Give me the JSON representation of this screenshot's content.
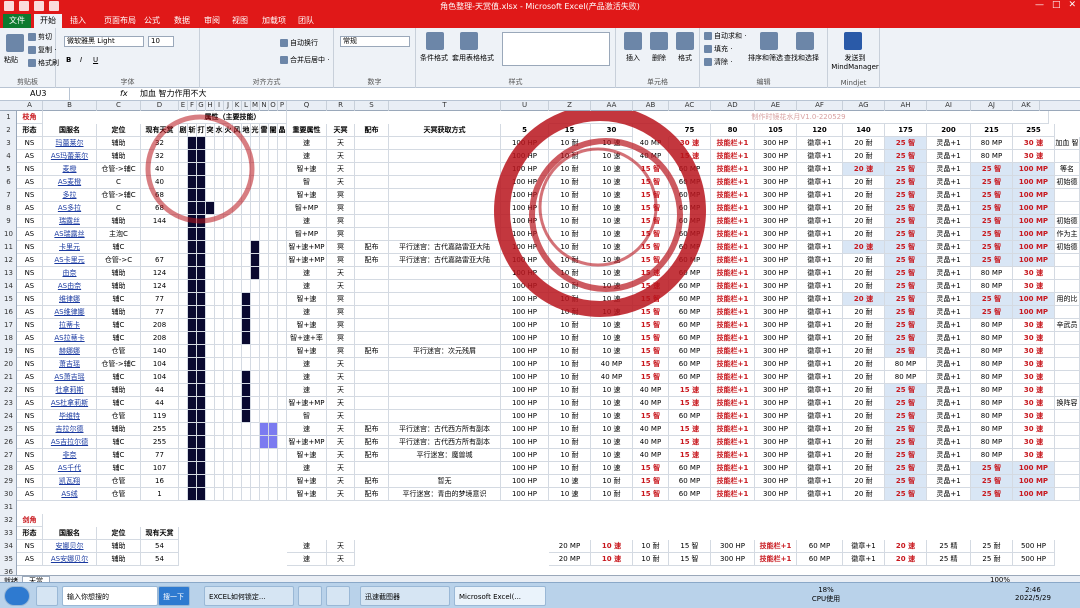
{
  "window": {
    "title": "角色整理-天赏值.xlsx - Microsoft Excel(产品激活失败)"
  },
  "menu_tabs": [
    {
      "label": "文件"
    },
    {
      "label": "开始"
    },
    {
      "label": "插入"
    },
    {
      "label": "页面布局"
    },
    {
      "label": "公式"
    },
    {
      "label": "数据"
    },
    {
      "label": "审阅"
    },
    {
      "label": "视图"
    },
    {
      "label": "加载项"
    },
    {
      "label": "团队"
    }
  ],
  "ribbon": {
    "clipboard": {
      "paste": "粘贴",
      "cut": "剪切",
      "copy": "复制 ·",
      "format_painter": "格式刷",
      "label": "剪贴板"
    },
    "font": {
      "name": "微软雅黑 Light",
      "size": "10",
      "bold": "B",
      "italic": "I",
      "underline": "U",
      "label": "字体"
    },
    "alignment": {
      "wrap": "自动换行",
      "merge": "合并后居中 ·",
      "label": "对齐方式"
    },
    "number": {
      "format": "常规",
      "label": "数字"
    },
    "styles": {
      "conditional": "条件格式",
      "table": "套用表格格式",
      "label": "样式"
    },
    "cells": {
      "insert": "插入",
      "delete": "删除",
      "format": "格式",
      "label": "单元格"
    },
    "editing": {
      "autosum": "自动求和 ·",
      "fill": "填充 ·",
      "clear": "清除 ·",
      "sort": "排序和筛选",
      "find": "查找和选择",
      "label": "编辑"
    },
    "mindjet": {
      "send": "发送到 MindManager",
      "label": "Mindjet"
    }
  },
  "formula_bar": {
    "name_box": "AU3",
    "fx": "fx",
    "content": "加血 智力作用不大"
  },
  "columns": [
    "A",
    "B",
    "C",
    "D",
    "E",
    "F",
    "G",
    "H",
    "I",
    "J",
    "K",
    "L",
    "M",
    "N",
    "O",
    "P",
    "Q",
    "R",
    "S",
    "T",
    "U",
    "Z",
    "AA",
    "AB",
    "AC",
    "AD",
    "AE",
    "AF",
    "AG",
    "AH",
    "AI",
    "AJ",
    "AK",
    "AL",
    "AM",
    "AN",
    "AO",
    "AP",
    "AQ",
    "AR",
    "AS",
    "AT"
  ],
  "group_title": "属性（主要技能）",
  "watermark": "制作时镜花水月V1.0-220529",
  "headers": {
    "section_a": "枝角",
    "row2": [
      "形态",
      "国服名",
      "定位",
      "现有天赏"
    ],
    "attr_letters": [
      "剧",
      "斩",
      "打",
      "突",
      "水",
      "火",
      "风",
      "地",
      "光",
      "雷",
      "闇",
      "晶"
    ],
    "key_attr": "重要属性",
    "tianming": "天冥",
    "peifu": "配布",
    "method": "天冥获取方式",
    "levels": [
      "5",
      "15",
      "30",
      "75",
      "80",
      "105",
      "120",
      "140",
      "175",
      "200",
      "215",
      "255"
    ]
  },
  "rows": [
    {
      "r": "3",
      "form": "NS",
      "name": "玛蕾莱尔",
      "role": "辅助",
      "cnt": "32",
      "key": "速",
      "tm": "天",
      "pf": "",
      "src": "",
      "v": [
        "100 HP",
        "10 耐",
        "10 速",
        "40 MP",
        "30 速",
        "技能栏+1",
        "300 HP",
        "徽章+1",
        "20 耐",
        "25 智",
        "灵晶+1",
        "80 MP",
        "30 速"
      ],
      "note": "加血 智"
    },
    {
      "r": "4",
      "form": "AS",
      "name": "AS玛蕾莱尔",
      "role": "辅助",
      "cnt": "32",
      "key": "速",
      "tm": "天",
      "pf": "",
      "src": "",
      "v": [
        "100 HP",
        "10 耐",
        "10 速",
        "40 MP",
        "15 速",
        "技能栏+1",
        "300 HP",
        "徽章+1",
        "20 耐",
        "25 智",
        "灵晶+1",
        "80 MP",
        "30 速"
      ],
      "note": ""
    },
    {
      "r": "5",
      "form": "NS",
      "name": "麦橙",
      "role": "仓管->辅C",
      "cnt": "40",
      "key": "智+速",
      "tm": "天",
      "pf": "",
      "src": "",
      "v": [
        "100 HP",
        "10 耐",
        "10 速",
        "15 智",
        "60 MP",
        "技能栏+1",
        "300 HP",
        "徽章+1",
        "20 速",
        "25 智",
        "灵晶+1",
        "25 智",
        "100 MP"
      ],
      "note": "等名"
    },
    {
      "r": "6",
      "form": "AS",
      "name": "AS麦橙",
      "role": "C",
      "cnt": "40",
      "key": "智",
      "tm": "天",
      "pf": "",
      "src": "",
      "v": [
        "100 HP",
        "10 耐",
        "10 速",
        "15 智",
        "60 MP",
        "技能栏+1",
        "300 HP",
        "徽章+1",
        "20 耐",
        "25 智",
        "灵晶+1",
        "25 智",
        "100 MP"
      ],
      "note": "初始德"
    },
    {
      "r": "7",
      "form": "NS",
      "name": "多拉",
      "role": "仓管->辅C",
      "cnt": "68",
      "key": "智+速",
      "tm": "冥",
      "pf": "",
      "src": "",
      "v": [
        "100 HP",
        "10 耐",
        "10 速",
        "15 智",
        "60 MP",
        "技能栏+1",
        "300 HP",
        "徽章+1",
        "20 耐",
        "25 智",
        "灵晶+1",
        "25 智",
        "100 MP"
      ],
      "note": ""
    },
    {
      "r": "8",
      "form": "AS",
      "name": "AS多拉",
      "role": "C",
      "cnt": "68",
      "key": "智+MP",
      "tm": "冥",
      "pf": "",
      "src": "",
      "v": [
        "100 HP",
        "10 耐",
        "10 速",
        "15 智",
        "60 MP",
        "技能栏+1",
        "300 HP",
        "徽章+1",
        "20 耐",
        "25 智",
        "灵晶+1",
        "25 智",
        "100 MP"
      ],
      "note": ""
    },
    {
      "r": "9",
      "form": "NS",
      "name": "瑞露丝",
      "role": "辅助",
      "cnt": "144",
      "key": "速",
      "tm": "冥",
      "pf": "",
      "src": "",
      "v": [
        "100 HP",
        "10 耐",
        "10 速",
        "15 智",
        "60 MP",
        "技能栏+1",
        "300 HP",
        "徽章+1",
        "20 耐",
        "25 智",
        "灵晶+1",
        "25 智",
        "100 MP"
      ],
      "note": "初始德"
    },
    {
      "r": "10",
      "form": "AS",
      "name": "AS瑞露丝",
      "role": "主泡C",
      "cnt": "",
      "key": "智+MP",
      "tm": "冥",
      "pf": "",
      "src": "",
      "v": [
        "100 HP",
        "10 耐",
        "10 速",
        "15 智",
        "60 MP",
        "技能栏+1",
        "300 HP",
        "徽章+1",
        "20 耐",
        "25 智",
        "灵晶+1",
        "25 智",
        "100 MP"
      ],
      "note": "作为主"
    },
    {
      "r": "11",
      "form": "NS",
      "name": "卡里元",
      "role": "辅C",
      "cnt": "",
      "key": "智+速+MP",
      "tm": "冥",
      "pf": "配布",
      "src": "平行迷宫：古代嘉路雷亚大陆",
      "v": [
        "100 HP",
        "10 耐",
        "10 速",
        "15 智",
        "60 MP",
        "技能栏+1",
        "300 HP",
        "徽章+1",
        "20 速",
        "25 智",
        "灵晶+1",
        "25 智",
        "100 MP"
      ],
      "note": "初始德"
    },
    {
      "r": "12",
      "form": "AS",
      "name": "AS卡里元",
      "role": "仓管->C",
      "cnt": "67",
      "key": "智+速+MP",
      "tm": "冥",
      "pf": "配布",
      "src": "平行迷宫：古代嘉路雷亚大陆",
      "v": [
        "100 HP",
        "10 耐",
        "10 速",
        "15 智",
        "60 MP",
        "技能栏+1",
        "300 HP",
        "徽章+1",
        "20 耐",
        "25 智",
        "灵晶+1",
        "25 智",
        "100 MP"
      ],
      "note": ""
    },
    {
      "r": "13",
      "form": "NS",
      "name": "由奈",
      "role": "辅助",
      "cnt": "124",
      "key": "速",
      "tm": "天",
      "pf": "",
      "src": "",
      "v": [
        "100 HP",
        "10 耐",
        "10 速",
        "15 速",
        "60 MP",
        "技能栏+1",
        "300 HP",
        "徽章+1",
        "20 耐",
        "25 智",
        "灵晶+1",
        "80 MP",
        "30 速"
      ],
      "note": ""
    },
    {
      "r": "14",
      "form": "AS",
      "name": "AS由奈",
      "role": "辅助",
      "cnt": "124",
      "key": "速",
      "tm": "天",
      "pf": "",
      "src": "",
      "v": [
        "100 HP",
        "10 耐",
        "10 速",
        "15 速",
        "60 MP",
        "技能栏+1",
        "300 HP",
        "徽章+1",
        "20 耐",
        "25 智",
        "灵晶+1",
        "80 MP",
        "30 速"
      ],
      "note": ""
    },
    {
      "r": "15",
      "form": "NS",
      "name": "维律娜",
      "role": "辅C",
      "cnt": "77",
      "key": "智+速",
      "tm": "冥",
      "pf": "",
      "src": "",
      "v": [
        "100 HP",
        "10 耐",
        "10 速",
        "15 智",
        "60 MP",
        "技能栏+1",
        "300 HP",
        "徽章+1",
        "20 速",
        "25 智",
        "灵晶+1",
        "25 智",
        "100 MP"
      ],
      "note": "用的比"
    },
    {
      "r": "16",
      "form": "AS",
      "name": "AS维律娜",
      "role": "辅助",
      "cnt": "77",
      "key": "速",
      "tm": "冥",
      "pf": "",
      "src": "",
      "v": [
        "100 HP",
        "10 耐",
        "10 速",
        "15 智",
        "60 MP",
        "技能栏+1",
        "300 HP",
        "徽章+1",
        "20 耐",
        "25 智",
        "灵晶+1",
        "25 智",
        "100 MP"
      ],
      "note": ""
    },
    {
      "r": "17",
      "form": "NS",
      "name": "拉蒂卡",
      "role": "辅C",
      "cnt": "208",
      "key": "智+速",
      "tm": "冥",
      "pf": "",
      "src": "",
      "v": [
        "100 HP",
        "10 耐",
        "10 速",
        "15 智",
        "60 MP",
        "技能栏+1",
        "300 HP",
        "徽章+1",
        "20 耐",
        "25 智",
        "灵晶+1",
        "80 MP",
        "30 速"
      ],
      "note": "辛武员"
    },
    {
      "r": "18",
      "form": "AS",
      "name": "AS拉蒂卡",
      "role": "辅C",
      "cnt": "208",
      "key": "智+速+率",
      "tm": "冥",
      "pf": "",
      "src": "",
      "v": [
        "100 HP",
        "10 耐",
        "10 速",
        "15 智",
        "60 MP",
        "技能栏+1",
        "300 HP",
        "徽章+1",
        "20 耐",
        "25 智",
        "灵晶+1",
        "80 MP",
        "30 速"
      ],
      "note": ""
    },
    {
      "r": "19",
      "form": "NS",
      "name": "赫娜娜",
      "role": "仓管",
      "cnt": "140",
      "key": "智+速",
      "tm": "冥",
      "pf": "配布",
      "src": "平行迷宫：次元残屑",
      "v": [
        "100 HP",
        "10 耐",
        "10 速",
        "15 智",
        "60 MP",
        "技能栏+1",
        "300 HP",
        "徽章+1",
        "20 耐",
        "25 智",
        "灵晶+1",
        "80 MP",
        "30 速"
      ],
      "note": ""
    },
    {
      "r": "20",
      "form": "NS",
      "name": "萧吉瑶",
      "role": "仓管->辅C",
      "cnt": "104",
      "key": "速",
      "tm": "天",
      "pf": "",
      "src": "",
      "v": [
        "100 HP",
        "10 耐",
        "40 MP",
        "15 智",
        "60 MP",
        "技能栏+1",
        "300 HP",
        "徽章+1",
        "20 耐",
        "80 MP",
        "灵晶+1",
        "80 MP",
        "30 速"
      ],
      "note": ""
    },
    {
      "r": "21",
      "form": "AS",
      "name": "AS萧吉瑶",
      "role": "辅C",
      "cnt": "104",
      "key": "速",
      "tm": "天",
      "pf": "",
      "src": "",
      "v": [
        "100 HP",
        "10 耐",
        "40 MP",
        "15 智",
        "60 MP",
        "技能栏+1",
        "300 HP",
        "徽章+1",
        "20 耐",
        "80 MP",
        "灵晶+1",
        "80 MP",
        "30 速"
      ],
      "note": ""
    },
    {
      "r": "22",
      "form": "NS",
      "name": "杜拿莉斯",
      "role": "辅助",
      "cnt": "44",
      "key": "速",
      "tm": "天",
      "pf": "",
      "src": "",
      "v": [
        "100 HP",
        "10 耐",
        "10 速",
        "40 MP",
        "15 速",
        "技能栏+1",
        "300 HP",
        "徽章+1",
        "20 耐",
        "25 智",
        "灵晶+1",
        "80 MP",
        "30 速"
      ],
      "note": ""
    },
    {
      "r": "23",
      "form": "AS",
      "name": "AS杜拿莉斯",
      "role": "辅C",
      "cnt": "44",
      "key": "智+速+MP",
      "tm": "天",
      "pf": "",
      "src": "",
      "v": [
        "100 HP",
        "10 耐",
        "10 速",
        "40 MP",
        "15 速",
        "技能栏+1",
        "300 HP",
        "徽章+1",
        "20 耐",
        "25 智",
        "灵晶+1",
        "80 MP",
        "30 速"
      ],
      "note": "换阵容"
    },
    {
      "r": "24",
      "form": "NS",
      "name": "毕维特",
      "role": "仓管",
      "cnt": "119",
      "key": "智",
      "tm": "天",
      "pf": "",
      "src": "",
      "v": [
        "100 HP",
        "10 耐",
        "10 速",
        "15 智",
        "60 MP",
        "技能栏+1",
        "300 HP",
        "徽章+1",
        "20 耐",
        "25 智",
        "灵晶+1",
        "80 MP",
        "30 速"
      ],
      "note": ""
    },
    {
      "r": "25",
      "form": "NS",
      "name": "吉拉尔德",
      "role": "辅助",
      "cnt": "255",
      "key": "速",
      "tm": "天",
      "pf": "配布",
      "src": "平行迷宫：古代西方所有副本",
      "v": [
        "100 HP",
        "10 耐",
        "10 速",
        "40 MP",
        "15 速",
        "技能栏+1",
        "300 HP",
        "徽章+1",
        "20 耐",
        "25 智",
        "灵晶+1",
        "80 MP",
        "30 速"
      ],
      "note": ""
    },
    {
      "r": "26",
      "form": "AS",
      "name": "AS吉拉尔德",
      "role": "辅C",
      "cnt": "255",
      "key": "智+速+MP",
      "tm": "天",
      "pf": "配布",
      "src": "平行迷宫：古代西方所有副本",
      "v": [
        "100 HP",
        "10 耐",
        "10 速",
        "40 MP",
        "15 速",
        "技能栏+1",
        "300 HP",
        "徽章+1",
        "20 耐",
        "25 智",
        "灵晶+1",
        "80 MP",
        "30 速"
      ],
      "note": ""
    },
    {
      "r": "27",
      "form": "NS",
      "name": "非奈",
      "role": "辅C",
      "cnt": "77",
      "key": "智+速",
      "tm": "天",
      "pf": "配布",
      "src": "平行迷宫：魔兽城",
      "v": [
        "100 HP",
        "10 耐",
        "10 速",
        "40 MP",
        "15 速",
        "技能栏+1",
        "300 HP",
        "徽章+1",
        "20 耐",
        "25 智",
        "灵晶+1",
        "80 MP",
        "30 速"
      ],
      "note": ""
    },
    {
      "r": "28",
      "form": "AS",
      "name": "AS千代",
      "role": "辅C",
      "cnt": "107",
      "key": "速",
      "tm": "天",
      "pf": "",
      "src": "",
      "v": [
        "100 HP",
        "10 耐",
        "10 速",
        "15 智",
        "60 MP",
        "技能栏+1",
        "300 HP",
        "徽章+1",
        "20 耐",
        "25 智",
        "灵晶+1",
        "25 智",
        "100 MP"
      ],
      "note": ""
    },
    {
      "r": "29",
      "form": "NS",
      "name": "凯瓦翔",
      "role": "仓管",
      "cnt": "16",
      "key": "智+速",
      "tm": "天",
      "pf": "配布",
      "src": "暂无",
      "v": [
        "100 HP",
        "10 速",
        "10 耐",
        "15 智",
        "60 MP",
        "技能栏+1",
        "300 HP",
        "徽章+1",
        "20 耐",
        "25 智",
        "灵晶+1",
        "25 智",
        "100 MP"
      ],
      "note": ""
    },
    {
      "r": "30",
      "form": "AS",
      "name": "AS绒",
      "role": "仓管",
      "cnt": "1",
      "key": "智+速",
      "tm": "天",
      "pf": "配布",
      "src": "平行迷宫：青由的梦境意识",
      "v": [
        "100 HP",
        "10 速",
        "10 耐",
        "15 智",
        "60 MP",
        "技能栏+1",
        "300 HP",
        "徽章+1",
        "20 耐",
        "25 智",
        "灵晶+1",
        "25 智",
        "100 MP"
      ],
      "note": ""
    }
  ],
  "section_b": "剑角",
  "section_b_header": [
    "形态",
    "国服名",
    "定位",
    "现有天赏"
  ],
  "rows_b": [
    {
      "r": "34",
      "form": "NS",
      "name": "安娜贝尔",
      "role": "辅助",
      "cnt": "54",
      "key": "速",
      "tm": "天",
      "v": [
        "20 MP",
        "10 速",
        "10 耐",
        "15 智",
        "300 HP",
        "技能栏+1",
        "60 MP",
        "徽章+1",
        "20 速",
        "25 精",
        "25 耐",
        "500 HP"
      ]
    },
    {
      "r": "35",
      "form": "AS",
      "name": "AS安娜贝尔",
      "role": "辅助",
      "cnt": "54",
      "key": "速",
      "tm": "天",
      "v": [
        "20 MP",
        "10 速",
        "10 耐",
        "15 智",
        "300 HP",
        "技能栏+1",
        "60 MP",
        "徽章+1",
        "20 速",
        "25 精",
        "25 耐",
        "500 HP"
      ]
    }
  ],
  "sheet_tabs": [
    "天赏"
  ],
  "status": {
    "ready": "就绪",
    "zoom": "100%"
  },
  "taskbar": {
    "search_placeholder": "输入你想搜的",
    "search_btn": "搜一下",
    "items": [
      "EXCEL如何锁定...",
      "迅速截图器",
      "Microsoft Excel(..."
    ],
    "cpu": "18%",
    "cpu_label": "CPU使用",
    "time": "2:46",
    "date": "2022/5/29"
  }
}
